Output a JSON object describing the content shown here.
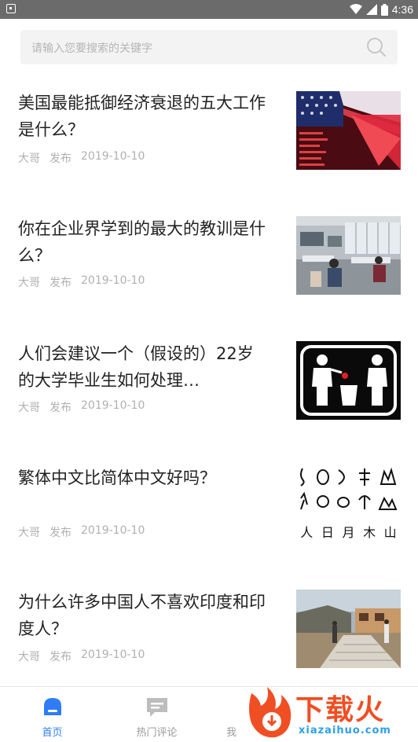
{
  "status_bar": {
    "time": "4:36"
  },
  "search": {
    "placeholder": "请输入您要搜索的关键字"
  },
  "articles": [
    {
      "title": "美国最能抵御经济衰退的五大工作是什么？",
      "author": "大哥",
      "action": "发布",
      "date": "2019-10-10",
      "thumb": "flag-market-image"
    },
    {
      "title": "你在企业界学到的最大的教训是什么？",
      "author": "大哥",
      "action": "发布",
      "date": "2019-10-10",
      "thumb": "office-image"
    },
    {
      "title": "人们会建议一个（假设的）22岁的大学毕业生如何处理…",
      "author": "大哥",
      "action": "发布",
      "date": "2019-10-10",
      "thumb": "recycle-sign-image"
    },
    {
      "title": "繁体中文比简体中文好吗？",
      "author": "大哥",
      "action": "发布",
      "date": "2019-10-10",
      "thumb": "glyph-chart-image",
      "glyph_labels": [
        "人",
        "日",
        "月",
        "木",
        "山"
      ]
    },
    {
      "title": "为什么许多中国人不喜欢印度和印度人？",
      "author": "大哥",
      "action": "发布",
      "date": "2019-10-10",
      "thumb": "street-image"
    }
  ],
  "tabs": [
    {
      "label": "首页",
      "active": true
    },
    {
      "label": "热门评论",
      "active": false
    },
    {
      "label": "我",
      "active": false
    }
  ],
  "watermark": {
    "brand": "下载火",
    "url": "xiazaihuo.com"
  },
  "colors": {
    "accent": "#2f7cf6",
    "title": "#222222",
    "meta": "#b0b0b0",
    "watermark": "#f04e23"
  }
}
